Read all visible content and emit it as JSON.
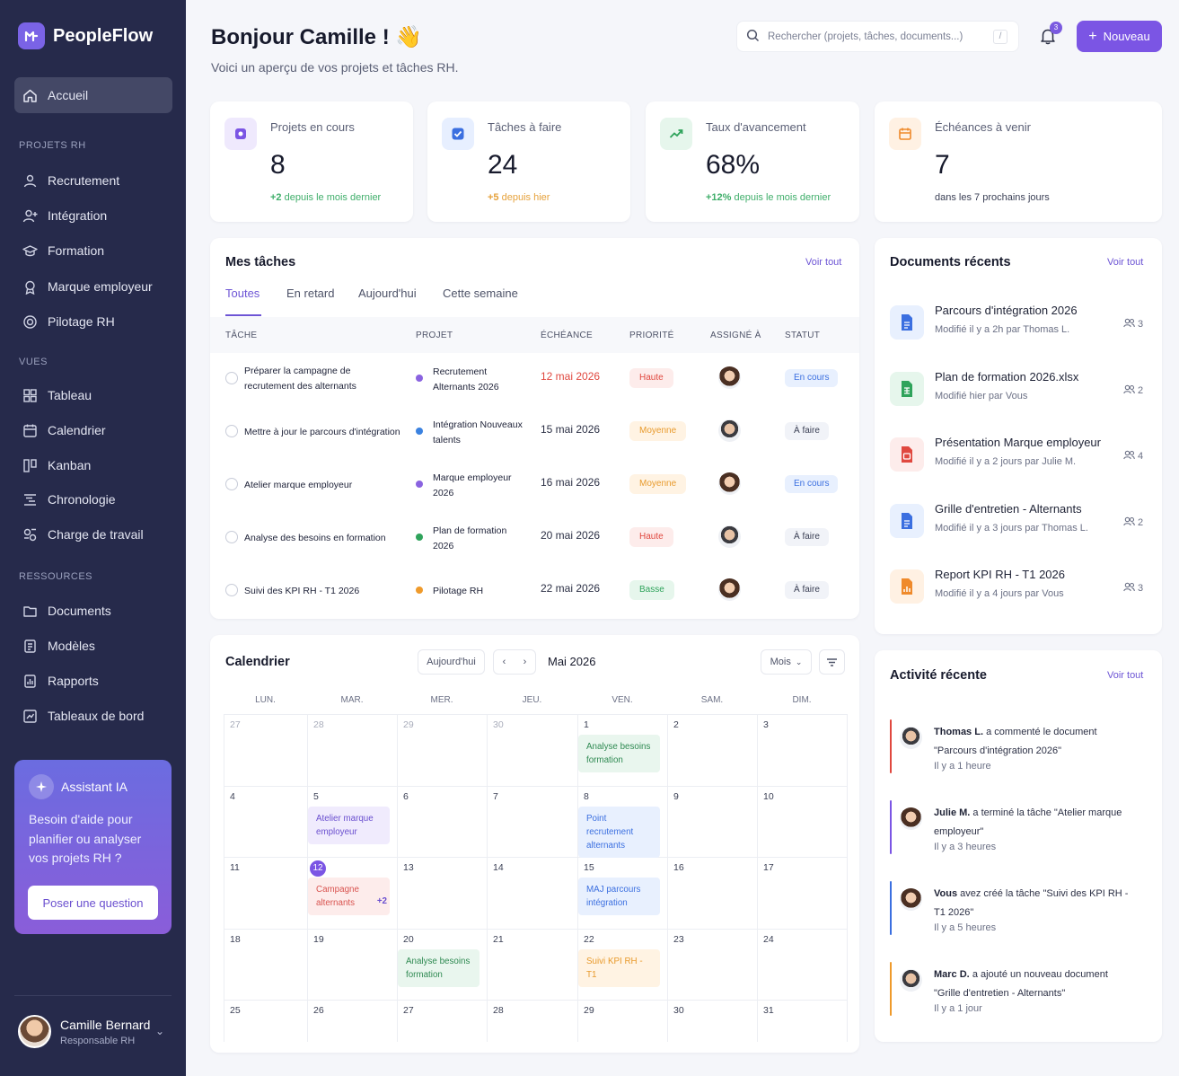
{
  "app": {
    "name": "PeopleFlow"
  },
  "sidebar": {
    "home": "Accueil",
    "sections": [
      {
        "title": "PROJETS RH",
        "items": [
          "Recrutement",
          "Intégration",
          "Formation",
          "Marque employeur",
          "Pilotage RH"
        ]
      },
      {
        "title": "VUES",
        "items": [
          "Tableau",
          "Calendrier",
          "Kanban",
          "Chronologie",
          "Charge de travail"
        ]
      },
      {
        "title": "RESSOURCES",
        "items": [
          "Documents",
          "Modèles",
          "Rapports",
          "Tableaux de bord"
        ]
      }
    ],
    "assistant": {
      "title": "Assistant IA",
      "text": "Besoin d'aide pour planifier ou analyser vos projets RH ?",
      "button": "Poser une question"
    },
    "user": {
      "name": "Camille Bernard",
      "role": "Responsable RH"
    }
  },
  "header": {
    "greeting": "Bonjour Camille ! 👋",
    "subtitle": "Voici un aperçu de vos projets et tâches RH.",
    "search_placeholder": "Rechercher (projets, tâches, documents...)",
    "search_shortcut": "/",
    "notifications": "3",
    "new_button": "Nouveau"
  },
  "stats": [
    {
      "label": "Projets en cours",
      "value": "8",
      "delta": "+2",
      "note": "depuis le mois dernier",
      "color": "#3fae6a",
      "icon_bg": "#efe9fd",
      "icon_color": "#7b55e4"
    },
    {
      "label": "Tâches à faire",
      "value": "24",
      "delta": "+5",
      "note": "depuis hier",
      "color": "#e6a23c",
      "icon_bg": "#e7efff",
      "icon_color": "#3b6fe0"
    },
    {
      "label": "Taux d'avancement",
      "value": "68%",
      "delta": "+12%",
      "note": "depuis le mois dernier",
      "color": "#3fae6a",
      "icon_bg": "#e6f6ec",
      "icon_color": "#2fa35b"
    },
    {
      "label": "Échéances à venir",
      "value": "7",
      "delta": "",
      "note": "dans les 7 prochains jours",
      "color": "#3a3f55",
      "icon_bg": "#fff1e3",
      "icon_color": "#ef8a2b"
    }
  ],
  "tasks": {
    "title": "Mes tâches",
    "see_all": "Voir tout",
    "tabs": [
      "Toutes",
      "En retard",
      "Aujourd'hui",
      "Cette semaine"
    ],
    "columns": [
      "TÂCHE",
      "PROJET",
      "ÉCHÉANCE",
      "PRIORITÉ",
      "ASSIGNÉ À",
      "STATUT"
    ],
    "rows": [
      {
        "task": "Préparer la campagne de recrutement des alternants",
        "project": "Recrutement Alternants 2026",
        "dot": "#8a63e0",
        "due": "12 mai 2026",
        "due_color": "#e0483f",
        "priority": "Haute",
        "prio_bg": "#fdeceb",
        "prio_fg": "#e0483f",
        "status": "En cours",
        "status_bg": "#e8f0fe",
        "status_fg": "#3b6fe0",
        "avatar": "f"
      },
      {
        "task": "Mettre à jour le parcours d'intégration",
        "project": "Intégration Nouveaux talents",
        "dot": "#3b82e0",
        "due": "15 mai 2026",
        "due_color": "#2c3045",
        "priority": "Moyenne",
        "prio_bg": "#fff3e3",
        "prio_fg": "#e89a2c",
        "status": "À faire",
        "status_bg": "#f1f3f8",
        "status_fg": "#3b4055",
        "avatar": "m"
      },
      {
        "task": "Atelier marque employeur",
        "project": "Marque employeur 2026",
        "dot": "#8a63e0",
        "due": "16 mai 2026",
        "due_color": "#2c3045",
        "priority": "Moyenne",
        "prio_bg": "#fff3e3",
        "prio_fg": "#e89a2c",
        "status": "En cours",
        "status_bg": "#e8f0fe",
        "status_fg": "#3b6fe0",
        "avatar": "f"
      },
      {
        "task": "Analyse des besoins en formation",
        "project": "Plan de formation 2026",
        "dot": "#2fa35b",
        "due": "20 mai 2026",
        "due_color": "#2c3045",
        "priority": "Haute",
        "prio_bg": "#fdeceb",
        "prio_fg": "#e0483f",
        "status": "À faire",
        "status_bg": "#f1f3f8",
        "status_fg": "#3b4055",
        "avatar": "m"
      },
      {
        "task": "Suivi des KPI RH - T1 2026",
        "project": "Pilotage RH",
        "dot": "#ef9a2b",
        "due": "22 mai 2026",
        "due_color": "#2c3045",
        "priority": "Basse",
        "prio_bg": "#e6f6ec",
        "prio_fg": "#2fa35b",
        "status": "À faire",
        "status_bg": "#f1f3f8",
        "status_fg": "#3b4055",
        "avatar": "f"
      }
    ]
  },
  "calendar": {
    "title": "Calendrier",
    "today_button": "Aujourd'hui",
    "month": "Mai 2026",
    "view": "Mois",
    "days": [
      "LUN.",
      "MAR.",
      "MER.",
      "JEU.",
      "VEN.",
      "SAM.",
      "DIM."
    ],
    "weeks": [
      [
        "27",
        "28",
        "29",
        "30",
        "1",
        "2",
        "3"
      ],
      [
        "4",
        "5",
        "6",
        "7",
        "8",
        "9",
        "10"
      ],
      [
        "11",
        "12",
        "13",
        "14",
        "15",
        "16",
        "17"
      ],
      [
        "18",
        "19",
        "20",
        "21",
        "22",
        "23",
        "24"
      ],
      [
        "25",
        "26",
        "27",
        "28",
        "29",
        "30",
        "31"
      ]
    ],
    "events": [
      {
        "week": 0,
        "day": 4,
        "text": "Analyse besoins formation",
        "bg": "#e9f6ee",
        "fg": "#2f8a52"
      },
      {
        "week": 1,
        "day": 1,
        "text": "Atelier marque employeur",
        "bg": "#f0ebfd",
        "fg": "#6a4fcf"
      },
      {
        "week": 1,
        "day": 4,
        "text": "Point recrutement alternants",
        "bg": "#e8f0fe",
        "fg": "#3b6fe0"
      },
      {
        "week": 2,
        "day": 1,
        "text": "Campagne alternants",
        "bg": "#fdeceb",
        "fg": "#d9534f",
        "more": "+2"
      },
      {
        "week": 2,
        "day": 4,
        "text": "MAJ parcours intégration",
        "bg": "#e8f0fe",
        "fg": "#3b6fe0"
      },
      {
        "week": 3,
        "day": 2,
        "text": "Analyse besoins formation",
        "bg": "#e9f6ee",
        "fg": "#2f8a52"
      },
      {
        "week": 3,
        "day": 4,
        "text": "Suivi KPI RH - T1",
        "bg": "#fff3e3",
        "fg": "#e89a2c"
      }
    ]
  },
  "documents": {
    "title": "Documents récents",
    "see_all": "Voir tout",
    "items": [
      {
        "name": "Parcours d'intégration 2026",
        "meta": "Modifié il y a 2h par Thomas L.",
        "share": "3",
        "icon": "doc-icon",
        "bg": "#e8f0fe",
        "fg": "#3b6fe0"
      },
      {
        "name": "Plan de formation 2026.xlsx",
        "meta": "Modifié hier par Vous",
        "share": "2",
        "icon": "sheet-icon",
        "bg": "#e6f6ec",
        "fg": "#2fa35b"
      },
      {
        "name": "Présentation Marque employeur",
        "meta": "Modifié il y a 2 jours par Julie M.",
        "share": "4",
        "icon": "slides-icon",
        "bg": "#fdeceb",
        "fg": "#e0483f"
      },
      {
        "name": "Grille d'entretien - Alternants",
        "meta": "Modifié il y a 3 jours par Thomas L.",
        "share": "2",
        "icon": "doc-icon",
        "bg": "#e8f0fe",
        "fg": "#3b6fe0"
      },
      {
        "name": "Report KPI RH - T1 2026",
        "meta": "Modifié il y a 4 jours par Vous",
        "share": "3",
        "icon": "report-icon",
        "bg": "#fff1e3",
        "fg": "#ef8a2b"
      }
    ]
  },
  "activity": {
    "title": "Activité récente",
    "see_all": "Voir tout",
    "items": [
      {
        "who": "Thomas L.",
        "text": "a commenté le document \"Parcours d'intégration 2026\"",
        "time": "Il y a 1 heure",
        "line": "#e0483f",
        "avatar": "m"
      },
      {
        "who": "Julie M.",
        "text": "a terminé la tâche \"Atelier marque employeur\"",
        "time": "Il y a 3 heures",
        "line": "#7b55e4",
        "avatar": "f"
      },
      {
        "who": "Vous",
        "text": "avez créé la tâche \"Suivi des KPI RH - T1 2026\"",
        "time": "Il y a 5 heures",
        "line": "#3b6fe0",
        "avatar": "f"
      },
      {
        "who": "Marc D.",
        "text": "a ajouté un nouveau document \"Grille d'entretien - Alternants\"",
        "time": "Il y a 1 jour",
        "line": "#ef9a2b",
        "avatar": "m"
      }
    ]
  }
}
